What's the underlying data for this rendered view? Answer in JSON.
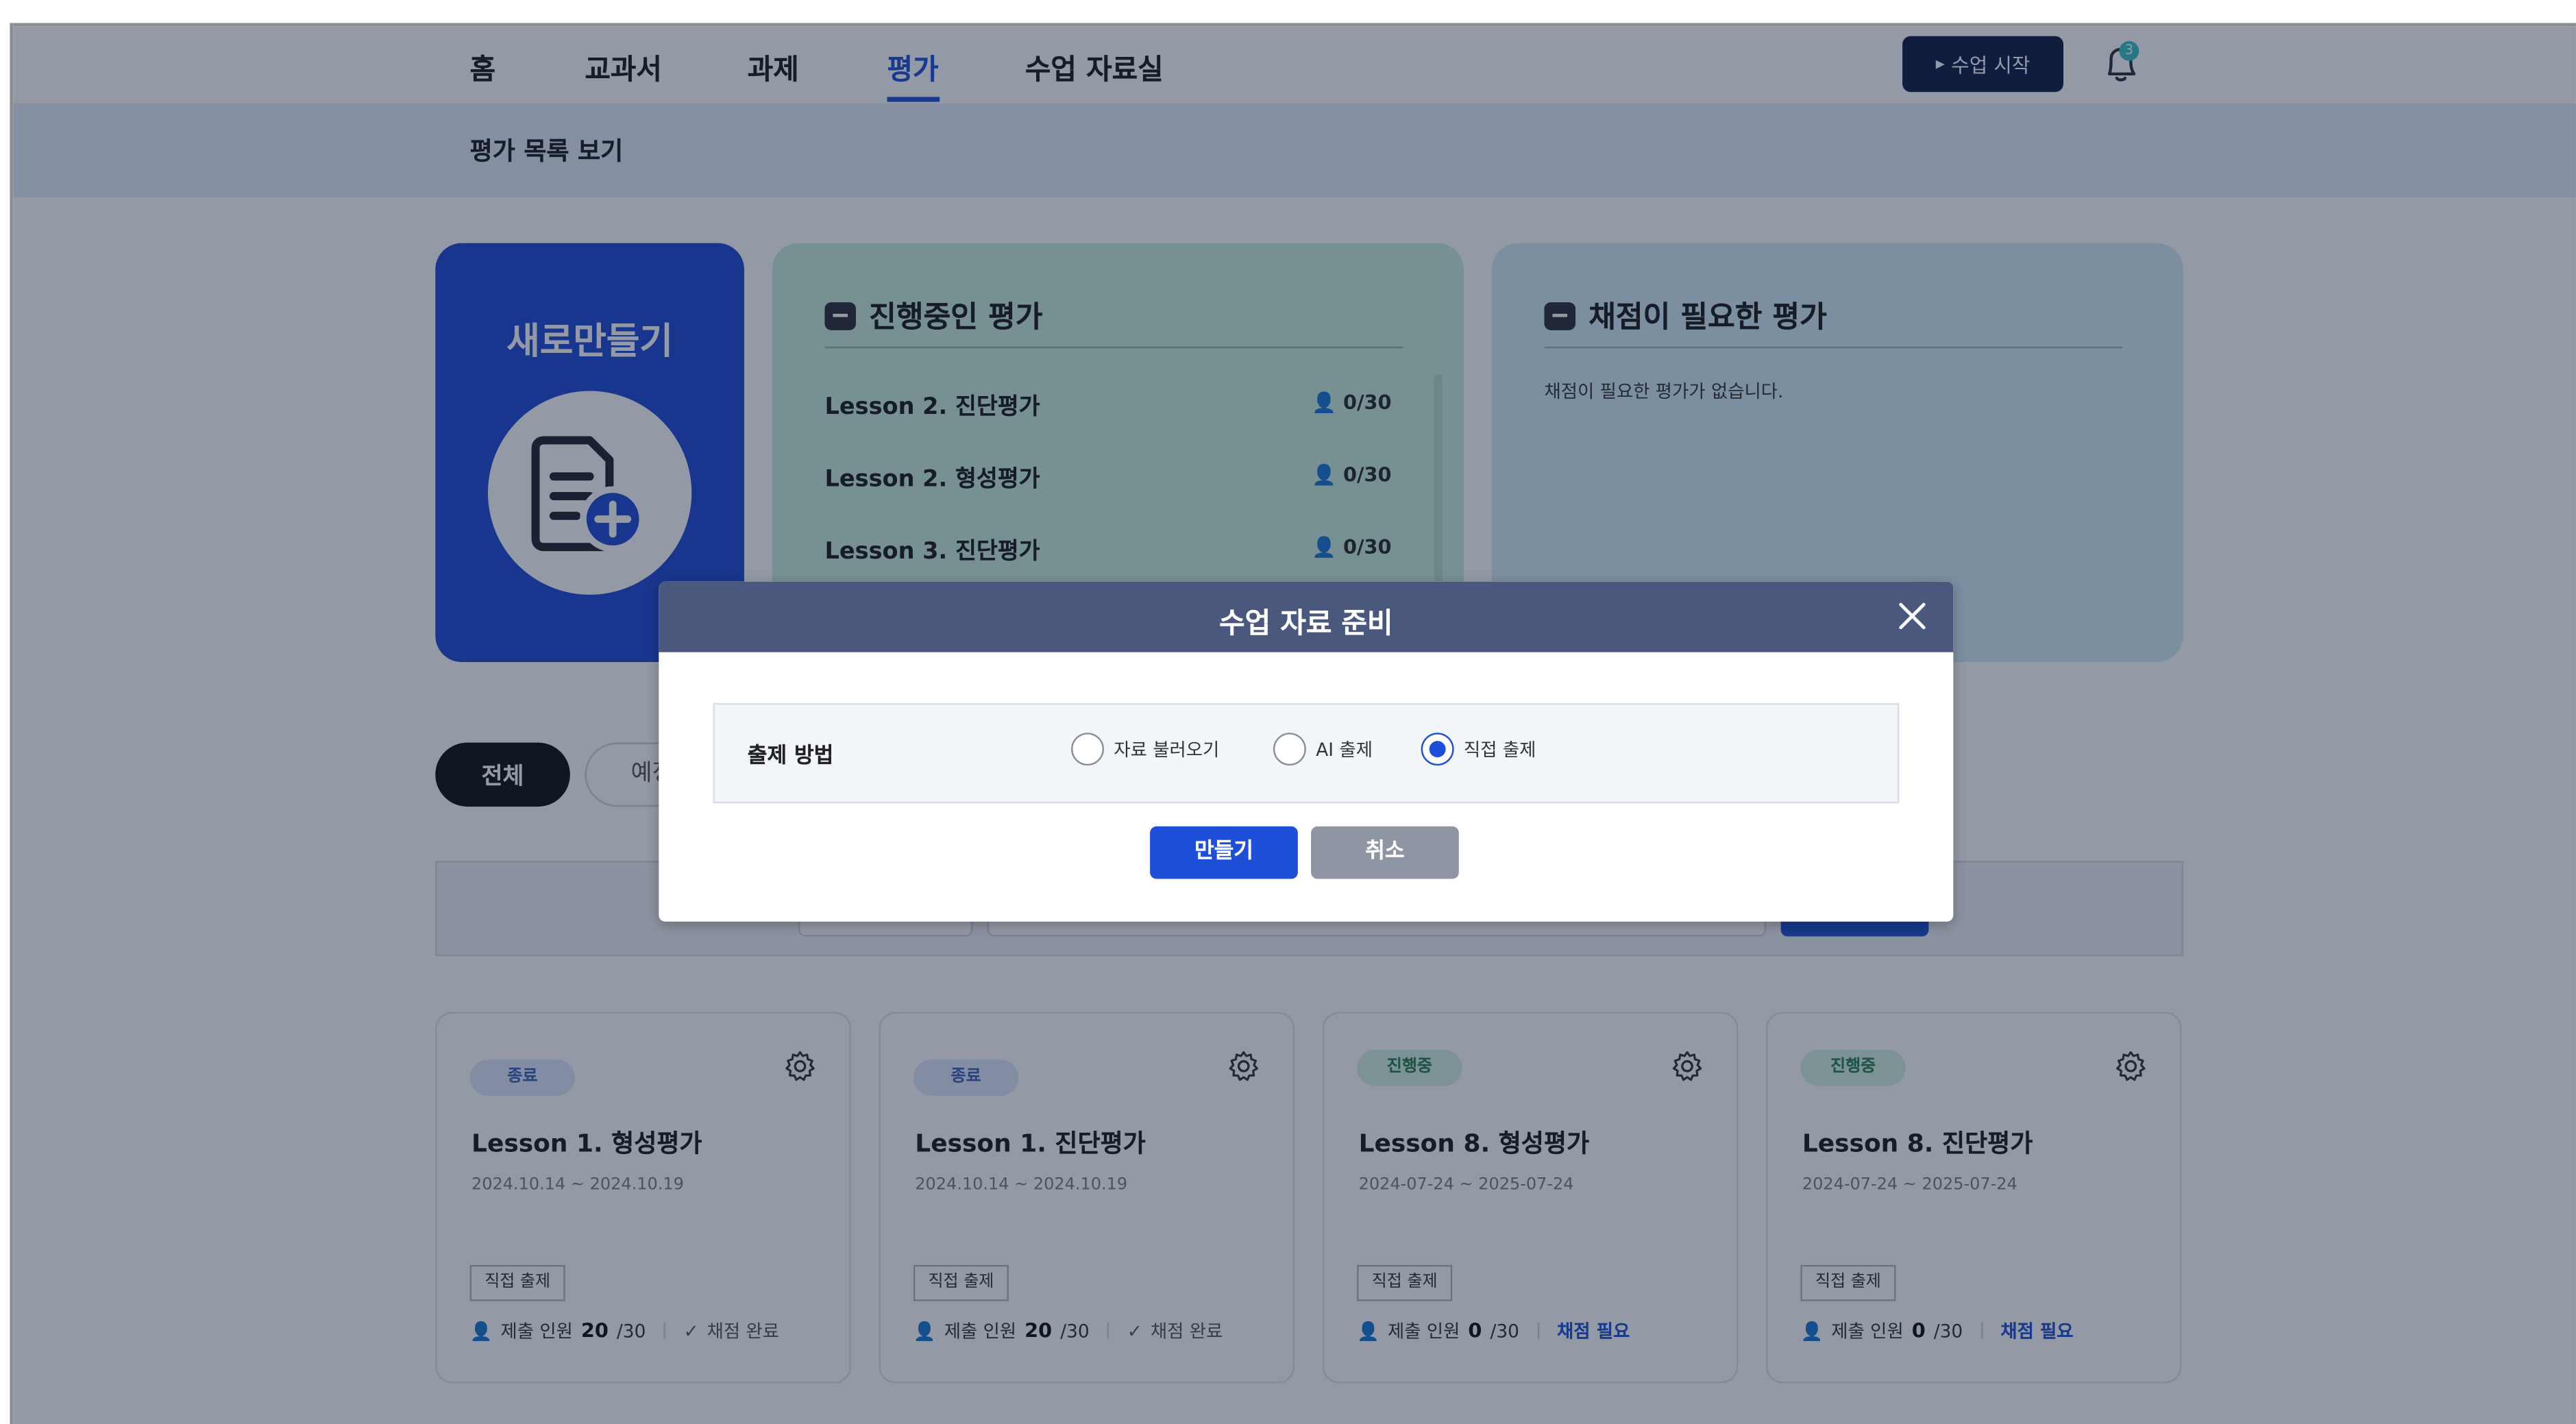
{
  "nav": {
    "items": [
      "홈",
      "교과서",
      "과제",
      "평가",
      "수업 자료실"
    ],
    "active_index": 3,
    "start_button": "수업 시작",
    "notification_count": "3"
  },
  "subbar": {
    "title": "평가 목록 보기"
  },
  "new_card": {
    "title": "새로만들기"
  },
  "in_progress": {
    "title": "진행중인 평가",
    "rows": [
      {
        "name": "Lesson 2. 진단평가",
        "count": "0/30"
      },
      {
        "name": "Lesson 2. 형성평가",
        "count": "0/30"
      },
      {
        "name": "Lesson 3. 진단평가",
        "count": "0/30"
      }
    ]
  },
  "needs_grading": {
    "title": "채점이 필요한 평가",
    "empty_message": "채점이 필요한 평가가 없습니다."
  },
  "filters": {
    "all": "전체",
    "second_partial": "예정"
  },
  "cards": [
    {
      "status": "종료",
      "status_type": "done",
      "title": "Lesson 1. 형성평가",
      "date": "2024.10.14 ~ 2024.10.19",
      "type": "직접 출제",
      "submit_label": "제출 인원",
      "submit_count": "20",
      "submit_total": "/30",
      "grade_state": "채점 완료",
      "grade_type": "ok"
    },
    {
      "status": "종료",
      "status_type": "done",
      "title": "Lesson 1. 진단평가",
      "date": "2024.10.14 ~ 2024.10.19",
      "type": "직접 출제",
      "submit_label": "제출 인원",
      "submit_count": "20",
      "submit_total": "/30",
      "grade_state": "채점 완료",
      "grade_type": "ok"
    },
    {
      "status": "진행중",
      "status_type": "ing",
      "title": "Lesson 8. 형성평가",
      "date": "2024-07-24 ~ 2025-07-24",
      "type": "직접 출제",
      "submit_label": "제출 인원",
      "submit_count": "0",
      "submit_total": "/30",
      "grade_state": "채점 필요",
      "grade_type": "need"
    },
    {
      "status": "진행중",
      "status_type": "ing",
      "title": "Lesson 8. 진단평가",
      "date": "2024-07-24 ~ 2025-07-24",
      "type": "직접 출제",
      "submit_label": "제출 인원",
      "submit_count": "0",
      "submit_total": "/30",
      "grade_state": "채점 필요",
      "grade_type": "need"
    }
  ],
  "modal": {
    "title": "수업 자료 준비",
    "option_label": "출제 방법",
    "options": [
      "자료 불러오기",
      "AI 출제",
      "직접 출제"
    ],
    "selected_index": 2,
    "make_button": "만들기",
    "cancel_button": "취소"
  },
  "colors": {
    "accent": "#1d4fd8",
    "nav_button": "#0f1d45",
    "modal_header": "#4a587d",
    "in_progress_card": "#cbeedf",
    "needs_grading_card": "#d3ecf8"
  }
}
